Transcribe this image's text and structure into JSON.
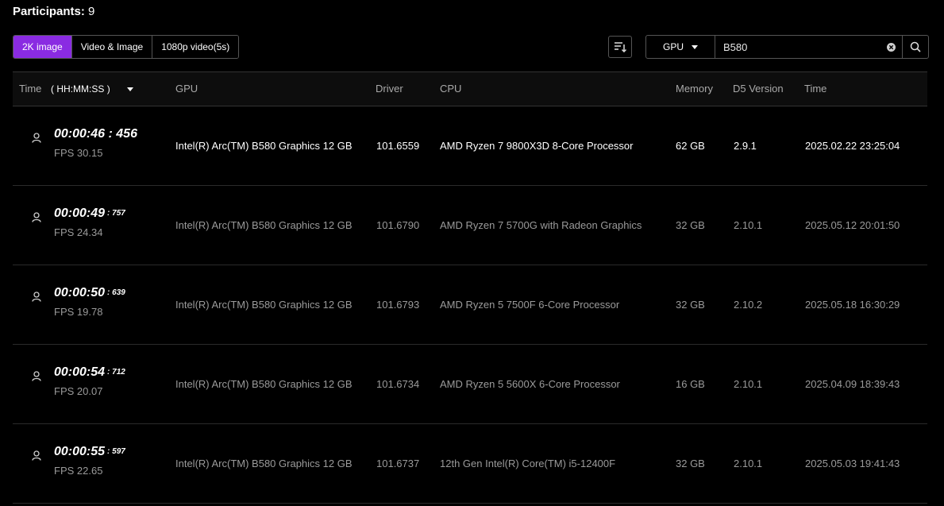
{
  "header": {
    "participants_label": "Participants:",
    "participants_count": "9"
  },
  "tabs": [
    {
      "label": "2K image",
      "active": true
    },
    {
      "label": "Video & Image",
      "active": false
    },
    {
      "label": "1080p video(5s)",
      "active": false
    }
  ],
  "toolbar": {
    "sort_icon": "sort-icon",
    "filter_value": "GPU",
    "search_value": "B580",
    "clear_icon": "clear-icon",
    "search_icon": "search-icon"
  },
  "colors": {
    "accent": "#8a2be2",
    "background": "#000000"
  },
  "table": {
    "columns": {
      "time": "Time",
      "time_format": "( HH:MM:SS )",
      "gpu": "GPU",
      "driver": "Driver",
      "cpu": "CPU",
      "memory": "Memory",
      "d5_version": "D5 Version",
      "date": "Time"
    },
    "rows": [
      {
        "time": "00:00:46",
        "ms": ": 456",
        "fps": "FPS 30.15",
        "gpu": "Intel(R) Arc(TM) B580 Graphics 12 GB",
        "driver": "101.6559",
        "cpu": "AMD Ryzen 7 9800X3D 8-Core Processor",
        "memory": "62 GB",
        "d5_version": "2.9.1",
        "date": "2025.02.22 23:25:04"
      },
      {
        "time": "00:00:49",
        "ms": ": 757",
        "fps": "FPS 24.34",
        "gpu": "Intel(R) Arc(TM) B580 Graphics 12 GB",
        "driver": "101.6790",
        "cpu": "AMD Ryzen 7 5700G with Radeon Graphics",
        "memory": "32 GB",
        "d5_version": "2.10.1",
        "date": "2025.05.12 20:01:50"
      },
      {
        "time": "00:00:50",
        "ms": ": 639",
        "fps": "FPS 19.78",
        "gpu": "Intel(R) Arc(TM) B580 Graphics 12 GB",
        "driver": "101.6793",
        "cpu": "AMD Ryzen 5 7500F 6-Core Processor",
        "memory": "32 GB",
        "d5_version": "2.10.2",
        "date": "2025.05.18 16:30:29"
      },
      {
        "time": "00:00:54",
        "ms": ": 712",
        "fps": "FPS 20.07",
        "gpu": "Intel(R) Arc(TM) B580 Graphics 12 GB",
        "driver": "101.6734",
        "cpu": "AMD Ryzen 5 5600X 6-Core Processor",
        "memory": "16 GB",
        "d5_version": "2.10.1",
        "date": "2025.04.09 18:39:43"
      },
      {
        "time": "00:00:55",
        "ms": ": 597",
        "fps": "FPS 22.65",
        "gpu": "Intel(R) Arc(TM) B580 Graphics 12 GB",
        "driver": "101.6737",
        "cpu": "12th Gen Intel(R) Core(TM) i5-12400F",
        "memory": "32 GB",
        "d5_version": "2.10.1",
        "date": "2025.05.03 19:41:43"
      }
    ]
  }
}
